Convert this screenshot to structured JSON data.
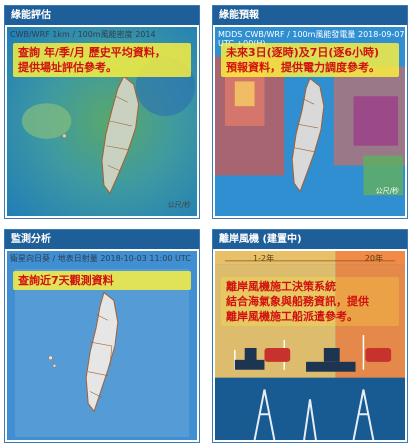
{
  "cards": [
    {
      "title": "綠能評估",
      "subtitle": "CWB/WRF 1km / 100m風能密度 2014",
      "overlay": "查詢 年/季/月 歷史平均資料，\n提供場址評估參考。",
      "legend": "公尺/秒"
    },
    {
      "title": "綠能預報",
      "subtitle": "MDDS CWB/WRF / 100m風能發電量 2018-09-07 00:00",
      "subtitle2": "UTC +00(H)",
      "overlay": "未來3日(逐時)及7日(逐6小時)\n預報資料，提供電力調度參考。",
      "legend": "公尺/秒"
    },
    {
      "title": "監測分析",
      "subtitle": "衛星向日葵 / 地表日射量 2018-10-03 11:00 UTC",
      "overlay": "查詢近7天觀測資料"
    },
    {
      "title": "離岸風機 (建置中)",
      "range_left": "1-2年",
      "range_right": "20年",
      "overlay": "離岸風機施工決策系統\n結合海氣象與船務資訊，提供\n離岸風機施工船派遣參考。"
    }
  ],
  "colors": {
    "header": "#1f5f99",
    "border": "#3a7ab5",
    "overlay_bg": "#fff13c",
    "overlay_text": "#d21010"
  }
}
